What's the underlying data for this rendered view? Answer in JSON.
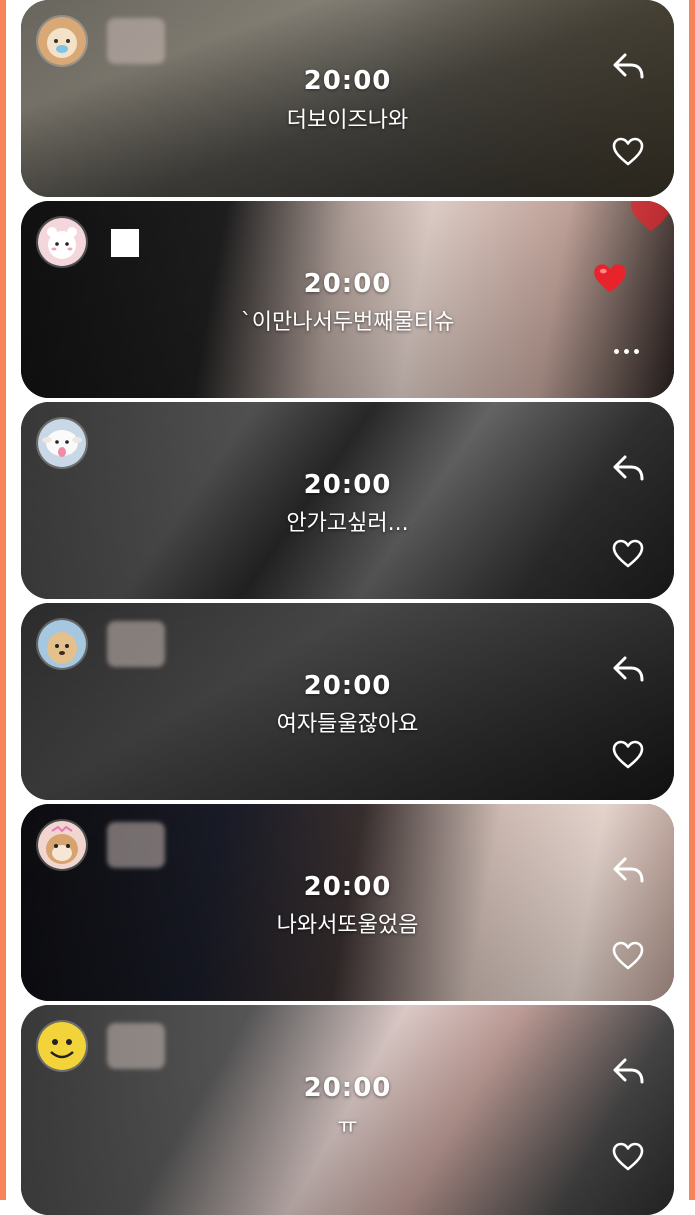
{
  "colors": {
    "frame": "#f7835b",
    "card_bg": "#1b1b1b",
    "text": "#ffffff",
    "heart_red": "#e8232b"
  },
  "posts": [
    {
      "time": "20:00",
      "caption": "더보이즈나와",
      "avatar_icon": "puppy-avatar-icon",
      "actions": [
        "reply-icon",
        "heart-outline-icon"
      ],
      "liked": false
    },
    {
      "time": "20:00",
      "caption": "`이만나서두번째물티슈",
      "avatar_icon": "bear-avatar-icon",
      "actions": [
        "heart-filled-icon",
        "more-icon"
      ],
      "liked": true
    },
    {
      "time": "20:00",
      "caption": "안가고싶러...",
      "avatar_icon": "sheep-avatar-icon",
      "actions": [
        "reply-icon",
        "heart-outline-icon"
      ],
      "liked": false
    },
    {
      "time": "20:00",
      "caption": "여자들울잖아요",
      "avatar_icon": "dog-avatar-icon",
      "actions": [
        "reply-icon",
        "heart-outline-icon"
      ],
      "liked": false
    },
    {
      "time": "20:00",
      "caption": "나와서또울었음",
      "avatar_icon": "hamster-avatar-icon",
      "actions": [
        "reply-icon",
        "heart-outline-icon"
      ],
      "liked": false
    },
    {
      "time": "20:00",
      "caption": "ㅠ",
      "avatar_icon": "smiley-avatar-icon",
      "actions": [
        "reply-icon",
        "heart-outline-icon"
      ],
      "liked": false
    }
  ]
}
